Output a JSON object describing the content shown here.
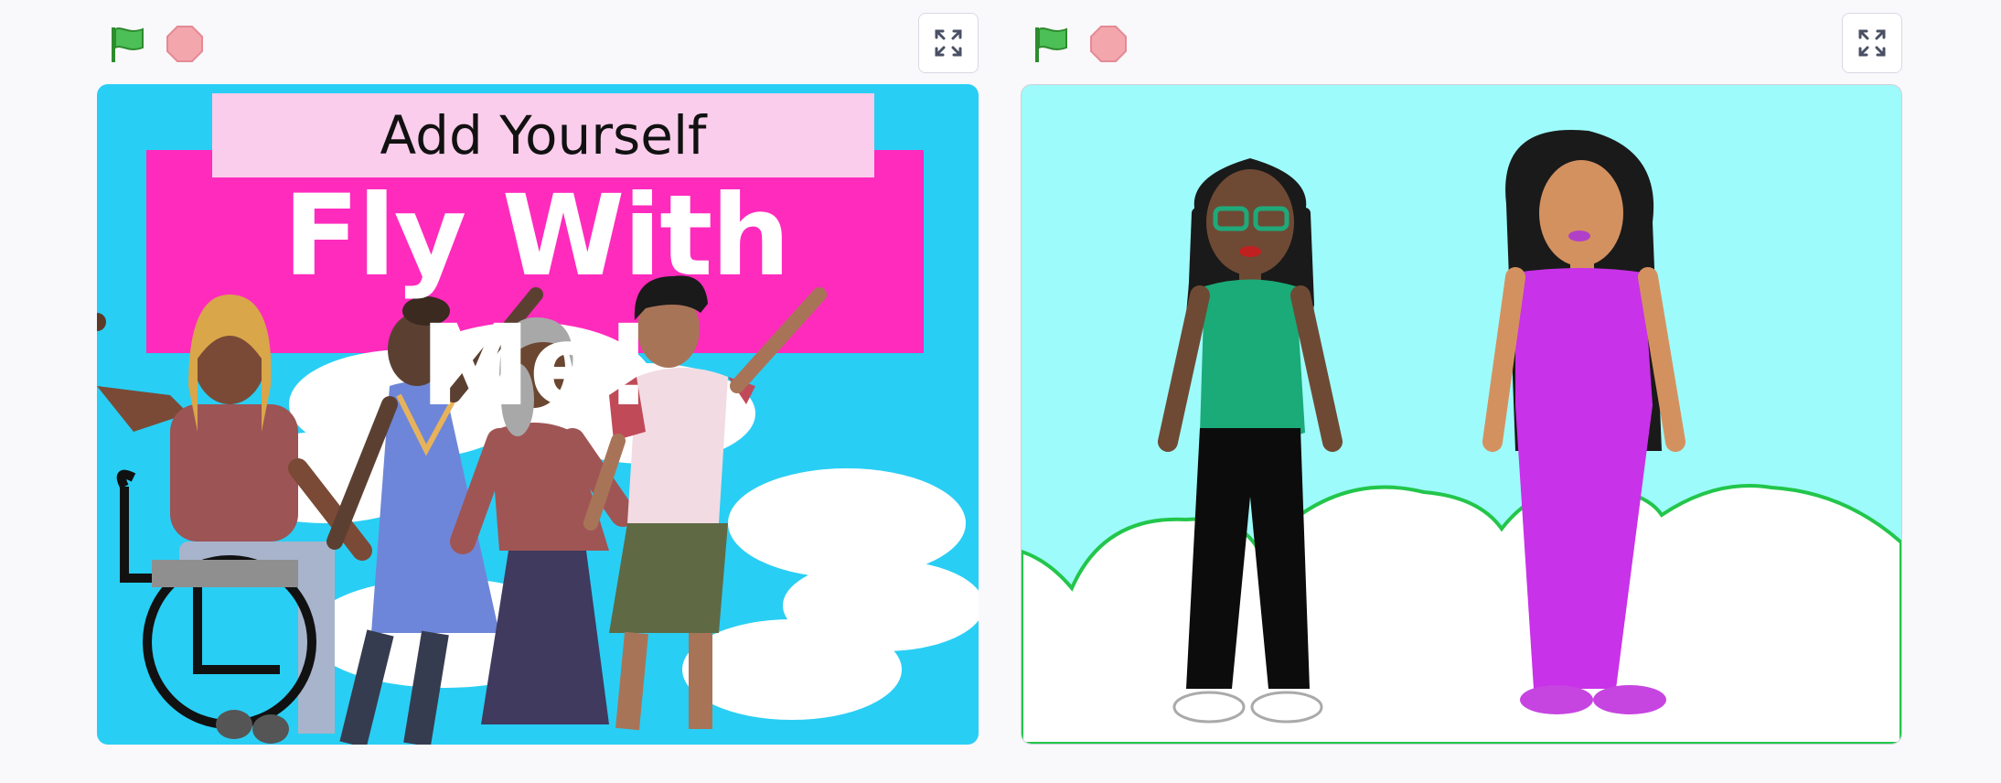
{
  "panels": [
    {
      "controls": {
        "green_flag": "green-flag-icon",
        "stop": "stop-icon",
        "fullscreen": "fullscreen-icon"
      },
      "stage": {
        "title": "Add Yourself",
        "banner": "Fly With Me!",
        "colors": {
          "sky": "#29cef4",
          "banner": "#ff2bbd",
          "title_box": "#fbcdec"
        }
      }
    },
    {
      "controls": {
        "green_flag": "green-flag-icon",
        "stop": "stop-icon",
        "fullscreen": "fullscreen-icon"
      },
      "stage": {
        "colors": {
          "sky": "#9efbfb",
          "hills": "#ffffff",
          "hill_outline": "#22c64b"
        }
      }
    }
  ]
}
